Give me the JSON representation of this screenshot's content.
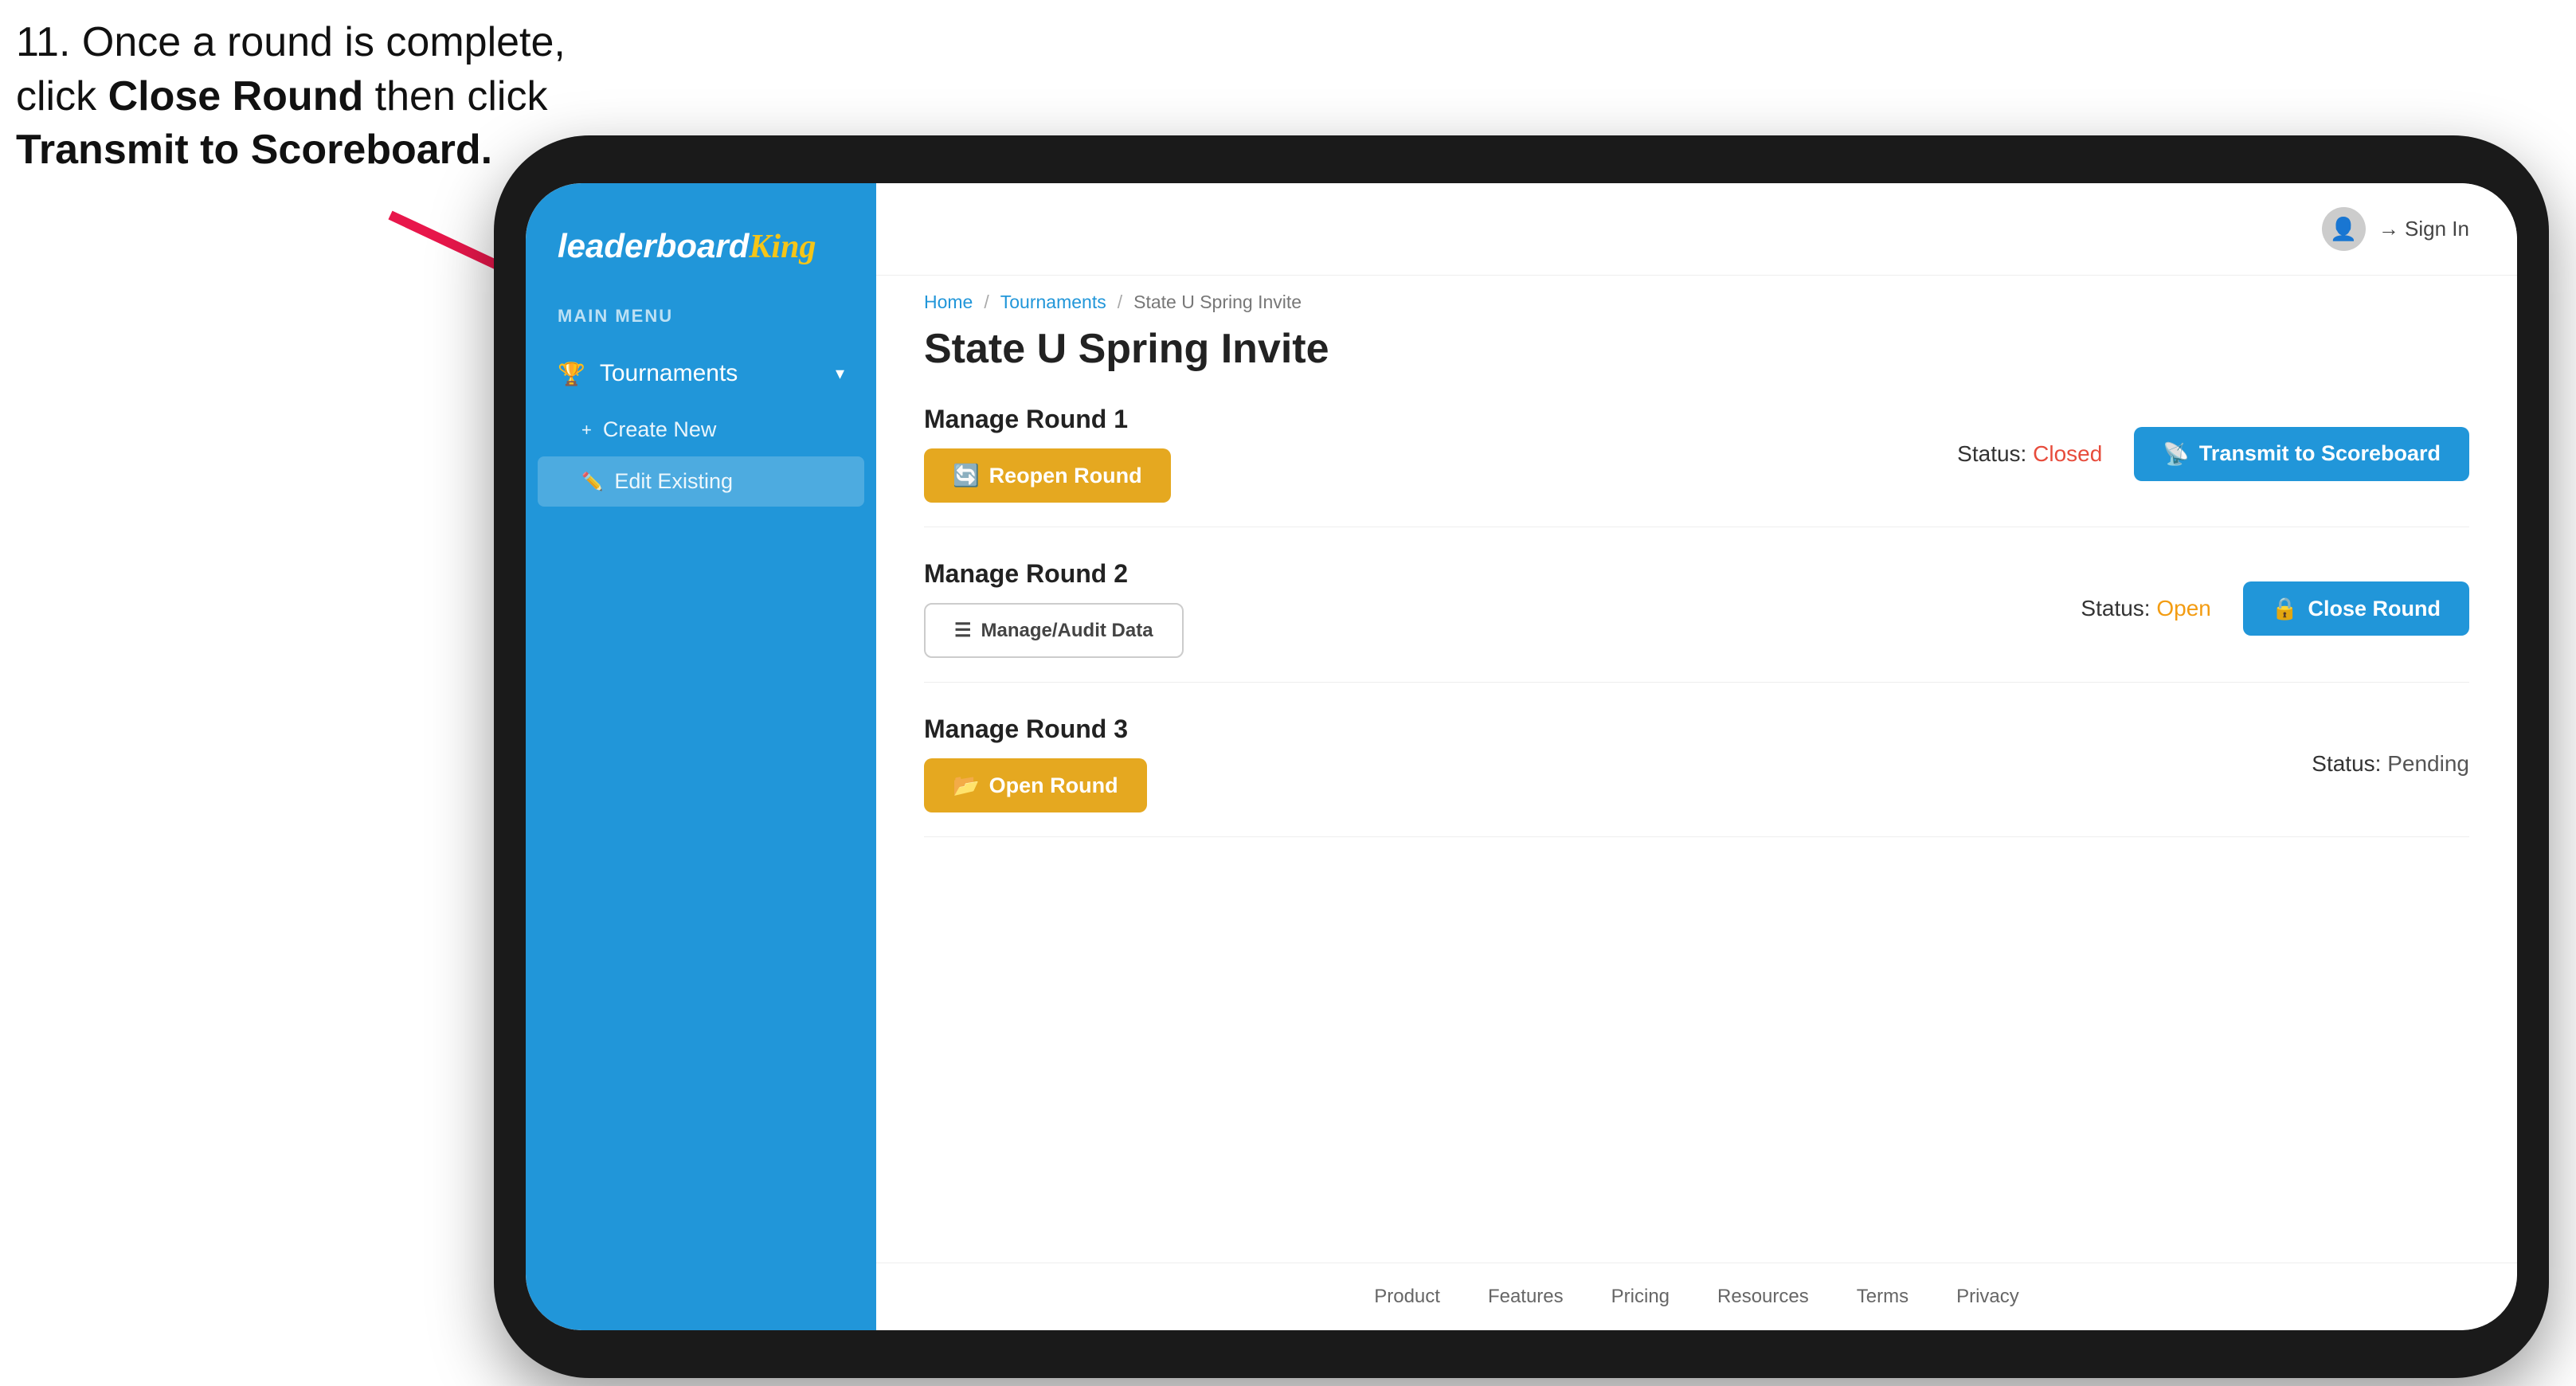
{
  "instruction": {
    "line1": "11. Once a round is complete,",
    "line2_prefix": "click ",
    "line2_bold": "Close Round",
    "line2_suffix": " then click",
    "line3_bold": "Transmit to Scoreboard."
  },
  "app": {
    "logo": {
      "part1": "leaderboard",
      "part2": "King"
    },
    "sidebar": {
      "menu_label": "MAIN MENU",
      "nav_items": [
        {
          "label": "Tournaments",
          "icon": "🏆",
          "expanded": true
        }
      ],
      "sub_items": [
        {
          "label": "Create New",
          "icon": "+"
        },
        {
          "label": "Edit Existing",
          "icon": "✏️",
          "active": true
        }
      ]
    },
    "header": {
      "sign_in_label": "Sign In"
    },
    "breadcrumb": {
      "home": "Home",
      "sep1": "/",
      "tournaments": "Tournaments",
      "sep2": "/",
      "current": "State U Spring Invite"
    },
    "page_title": "State U Spring Invite",
    "rounds": [
      {
        "label": "Manage Round 1",
        "status_label": "Status:",
        "status_value": "Closed",
        "status_class": "status-closed",
        "button1_label": "Reopen Round",
        "button1_class": "btn-gold",
        "button2_label": "Transmit to Scoreboard",
        "button2_class": "btn-blue",
        "has_button2": true
      },
      {
        "label": "Manage Round 2",
        "status_label": "Status:",
        "status_value": "Open",
        "status_class": "status-open",
        "button1_label": "Manage/Audit Data",
        "button1_class": "btn-outline",
        "button2_label": "Close Round",
        "button2_class": "btn-blue",
        "has_button2": true
      },
      {
        "label": "Manage Round 3",
        "status_label": "Status:",
        "status_value": "Pending",
        "status_class": "status-pending",
        "button1_label": "Open Round",
        "button1_class": "btn-gold",
        "has_button2": false
      }
    ],
    "footer": {
      "links": [
        "Product",
        "Features",
        "Pricing",
        "Resources",
        "Terms",
        "Privacy"
      ]
    }
  },
  "arrow": {
    "color": "#e8174b"
  }
}
